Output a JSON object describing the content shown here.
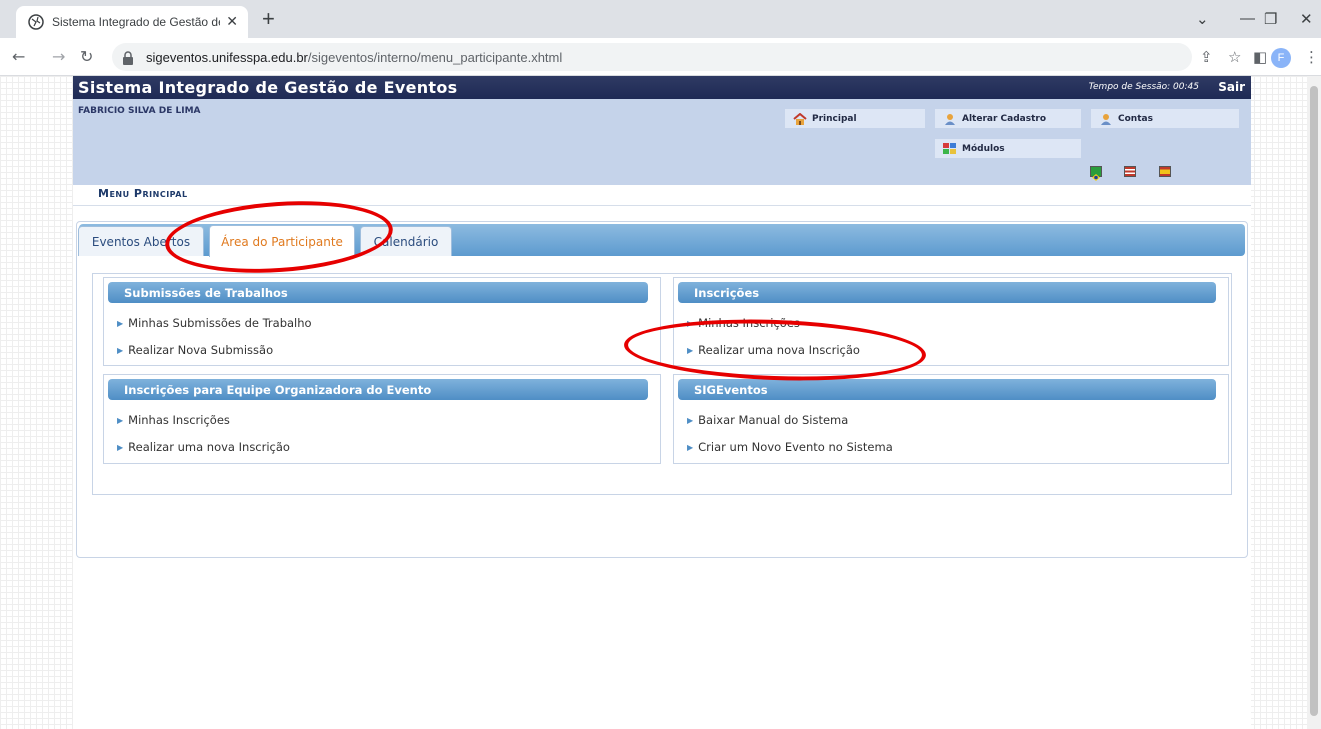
{
  "browser": {
    "tab_title": "Sistema Integrado de Gestão de E",
    "new_tab_label": "+",
    "url_host": "sigeventos.unifesspa.edu.br",
    "url_path": "/sigeventos/interno/menu_participante.xhtml",
    "profile_initial": "F"
  },
  "header": {
    "system_title": "Sistema Integrado de Gestão de Eventos",
    "session_label": "Tempo de Sessão: 00:45",
    "logout_label": "Sair",
    "user_name": "FABRICIO SILVA DE LIMA"
  },
  "quick_links": {
    "principal": "Principal",
    "alterar_cadastro": "Alterar Cadastro",
    "contas": "Contas",
    "modulos": "Módulos"
  },
  "menu_title": "Menu Principal",
  "tabs": [
    {
      "label": "Eventos Abertos"
    },
    {
      "label": "Área do Participante"
    },
    {
      "label": "Calendário"
    }
  ],
  "panels": {
    "submissoes": {
      "title": "Submissões de Trabalhos",
      "links": [
        "Minhas Submissões de Trabalho",
        "Realizar Nova Submissão"
      ]
    },
    "inscricoes": {
      "title": "Inscrições",
      "links": [
        "Minhas Inscrições",
        "Realizar uma nova Inscrição"
      ]
    },
    "equipe": {
      "title": "Inscrições para Equipe Organizadora do Evento",
      "links": [
        "Minhas Inscrições",
        "Realizar uma nova Inscrição"
      ]
    },
    "sigeventos": {
      "title": "SIGEventos",
      "links": [
        "Baixar Manual do Sistema",
        "Criar um Novo Evento no Sistema"
      ]
    }
  },
  "colors": {
    "header_bg": "#1e2a55",
    "panel_bg": "#c5d3ea",
    "tab_active_text": "#e07a1f",
    "annotation_ring": "#e60000"
  }
}
